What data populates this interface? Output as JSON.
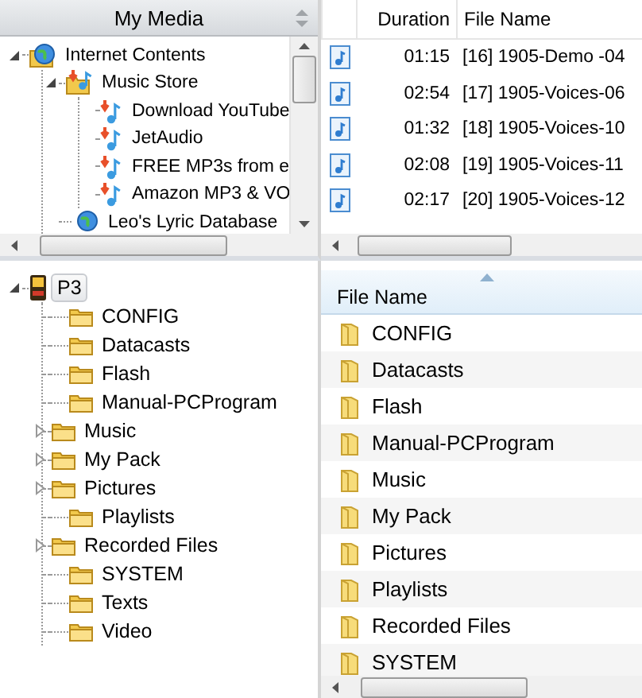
{
  "media_panel": {
    "title": "My Media",
    "tree": [
      {
        "label": "Internet Contents",
        "expanded": true,
        "children": [
          {
            "label": "Music Store",
            "expanded": true,
            "children": [
              {
                "label": "Download YouTube"
              },
              {
                "label": "JetAudio"
              },
              {
                "label": "FREE MP3s from e"
              },
              {
                "label": "Amazon MP3 & VO"
              }
            ]
          },
          {
            "label": "Leo's Lyric Database"
          }
        ]
      }
    ]
  },
  "track_table": {
    "columns": [
      "Duration",
      "File Name"
    ],
    "rows": [
      {
        "duration": "01:15",
        "file_name": "[16] 1905-Demo -04"
      },
      {
        "duration": "02:54",
        "file_name": "[17] 1905-Voices-06"
      },
      {
        "duration": "01:32",
        "file_name": "[18] 1905-Voices-10"
      },
      {
        "duration": "02:08",
        "file_name": "[19] 1905-Voices-11"
      },
      {
        "duration": "02:17",
        "file_name": "[20] 1905-Voices-12"
      }
    ]
  },
  "device_tree": {
    "label": "P3",
    "selected": true,
    "expanded": true,
    "children": [
      {
        "label": "CONFIG",
        "expandable": false
      },
      {
        "label": "Datacasts",
        "expandable": false
      },
      {
        "label": "Flash",
        "expandable": false
      },
      {
        "label": "Manual-PCProgram",
        "expandable": false
      },
      {
        "label": "Music",
        "expandable": true
      },
      {
        "label": "My Pack",
        "expandable": true
      },
      {
        "label": "Pictures",
        "expandable": true
      },
      {
        "label": "Playlists",
        "expandable": false
      },
      {
        "label": "Recorded Files",
        "expandable": true
      },
      {
        "label": "SYSTEM",
        "expandable": false
      },
      {
        "label": "Texts",
        "expandable": false
      },
      {
        "label": "Video",
        "expandable": false
      }
    ]
  },
  "folder_list": {
    "column": "File Name",
    "items": [
      "CONFIG",
      "Datacasts",
      "Flash",
      "Manual-PCProgram",
      "Music",
      "My Pack",
      "Pictures",
      "Playlists",
      "Recorded Files",
      "SYSTEM"
    ]
  }
}
